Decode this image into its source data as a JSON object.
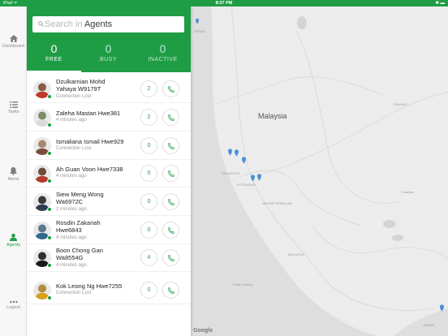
{
  "status_bar": {
    "left": "iPad ᯤ",
    "time": "8:07 PM",
    "right": "✱ ▬"
  },
  "nav": [
    {
      "label": "Dashboard",
      "icon": "home-icon"
    },
    {
      "label": "Tasks",
      "icon": "list-icon"
    },
    {
      "label": "Alerts",
      "icon": "bell-icon"
    },
    {
      "label": "Agents",
      "icon": "person-icon"
    },
    {
      "label": "Logout",
      "icon": "more-icon"
    }
  ],
  "search": {
    "placeholder": "Search in",
    "scope": "Agents"
  },
  "tabs": [
    {
      "count": "0",
      "label": "FREE"
    },
    {
      "count": "0",
      "label": "BUSY"
    },
    {
      "count": "0",
      "label": "INACTIVE"
    }
  ],
  "agents": [
    {
      "name": "Dzulkarnian Mohd Yahaya W9179T",
      "status": "Connection Lost",
      "count": "2",
      "avatar_bg": "#8a5a44",
      "shirt": "#c0392b"
    },
    {
      "name": "Zaleha Mastan Hwe381",
      "status": "4 minutes ago",
      "count": "2",
      "avatar_bg": "#7d8b6a",
      "shirt": "#d9d9d9"
    },
    {
      "name": "Ismaliana Ismail Hwe929",
      "status": "Connection Lost",
      "count": "0",
      "avatar_bg": "#a98873",
      "shirt": "#7a4e3a"
    },
    {
      "name": "Ah Guan Voon Hwe7338",
      "status": "4 minutes ago",
      "count": "0",
      "avatar_bg": "#6e4c3c",
      "shirt": "#b23a2e"
    },
    {
      "name": "Siew Meng Wong Wa6972C",
      "status": "2 minutes ago",
      "count": "0",
      "avatar_bg": "#3a3a3a",
      "shirt": "#2c3e50"
    },
    {
      "name": "Rosdin Zakariah Hwe6843",
      "status": "4 minutes ago",
      "count": "0",
      "avatar_bg": "#5c7a8a",
      "shirt": "#2e6b8a"
    },
    {
      "name": "Boon Chong Gan Wa8554G",
      "status": "4 minutes ago",
      "count": "4",
      "avatar_bg": "#2f2f2f",
      "shirt": "#1a1a1a"
    },
    {
      "name": "Kok Leong Ng Hwe7255",
      "status": "Connection Lost",
      "count": "0",
      "avatar_bg": "#b38a3a",
      "shirt": "#d4a017"
    }
  ],
  "map": {
    "country": "Malaysia",
    "labels": [
      "SELANGOR",
      "PUTRAJAYA",
      "NEGERI SEMBILAN",
      "MALACCA",
      "Pulau Pinang",
      "JOHOR",
      "PAHANG",
      "Kuantan",
      "PERAK"
    ],
    "attribution": "Google"
  },
  "colors": {
    "brand": "#1f9d45",
    "pin": "#4a90d9",
    "map_bg": "#ececec"
  }
}
